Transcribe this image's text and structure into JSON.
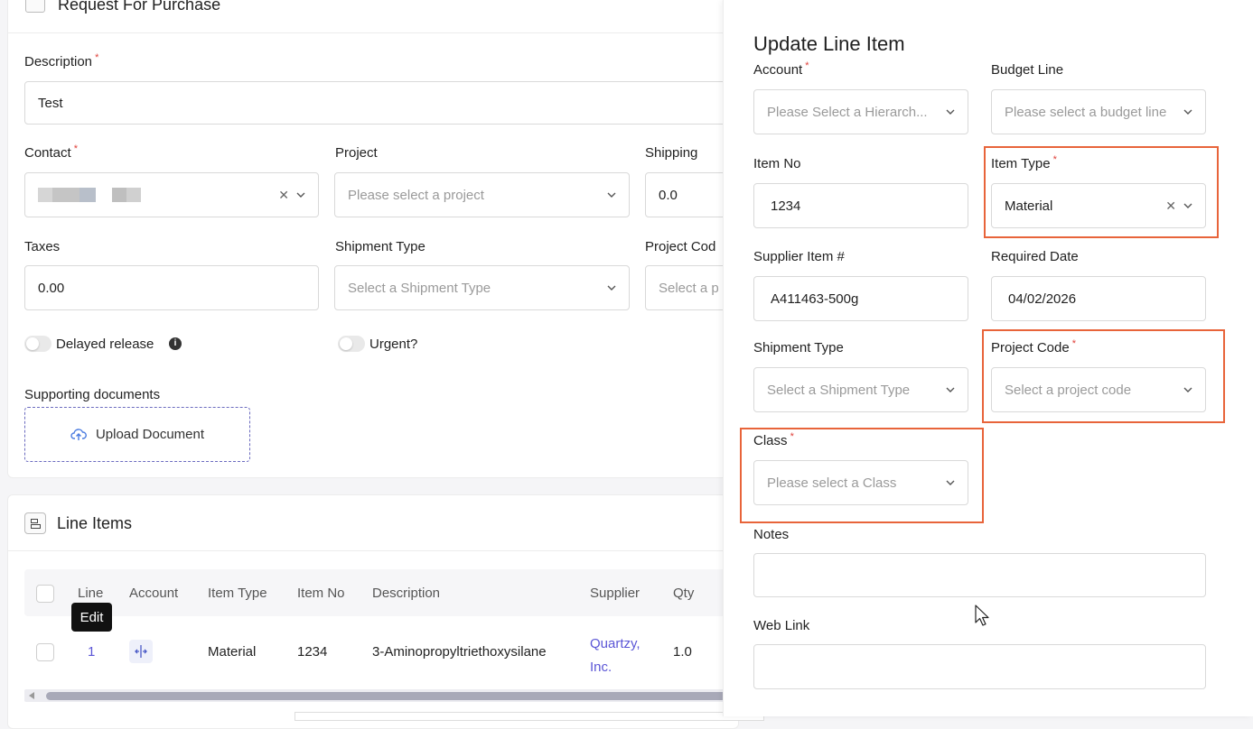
{
  "form": {
    "section_title": "Request For Purchase",
    "description_label": "Description",
    "description_value": "Test",
    "contact_label": "Contact",
    "project_label": "Project",
    "project_placeholder": "Please select a project",
    "shipping_label": "Shipping",
    "shipping_value": "0.0",
    "taxes_label": "Taxes",
    "taxes_value": "0.00",
    "shipment_type_label": "Shipment Type",
    "shipment_type_placeholder": "Select a Shipment Type",
    "project_code_label": "Project Cod",
    "project_code_placeholder": "Select a p",
    "delayed_release_label": "Delayed release",
    "urgent_label": "Urgent?",
    "supporting_docs_label": "Supporting documents",
    "upload_label": "Upload Document"
  },
  "line_items": {
    "title": "Line Items",
    "columns": [
      "Line",
      "Account",
      "Item Type",
      "Item No",
      "Description",
      "Supplier",
      "Qty"
    ],
    "tooltip": "Edit",
    "rows": [
      {
        "line": "1",
        "item_type": "Material",
        "item_no": "1234",
        "description": "3-Aminopropyltriethoxysilane",
        "supplier_line1": "Quartzy,",
        "supplier_line2": "Inc.",
        "qty": "1.0"
      }
    ]
  },
  "panel": {
    "title": "Update Line Item",
    "account_label": "Account",
    "account_placeholder": "Please Select a Hierarch...",
    "budget_line_label": "Budget Line",
    "budget_line_placeholder": "Please select a budget line",
    "item_no_label": "Item No",
    "item_no_value": "1234",
    "item_type_label": "Item Type",
    "item_type_value": "Material",
    "supplier_item_label": "Supplier Item #",
    "supplier_item_value": "A411463-500g",
    "required_date_label": "Required Date",
    "required_date_value": "04/02/2026",
    "shipment_type_label": "Shipment Type",
    "shipment_type_placeholder": "Select a Shipment Type",
    "project_code_label": "Project Code",
    "project_code_placeholder": "Select a project code",
    "class_label": "Class",
    "class_placeholder": "Please select a Class",
    "notes_label": "Notes",
    "web_link_label": "Web Link"
  },
  "colors": {
    "highlight": "#e8643a",
    "required": "#e0413a",
    "link": "#5b56d6",
    "accent": "#4a7be0"
  }
}
